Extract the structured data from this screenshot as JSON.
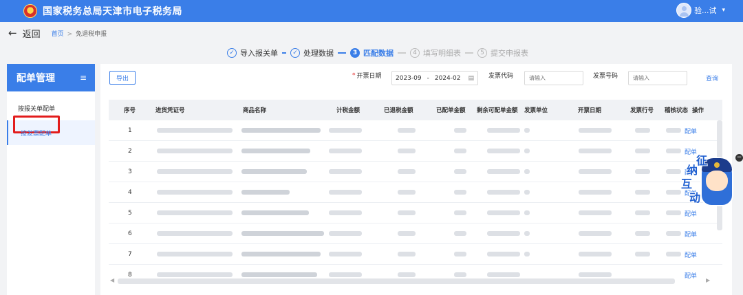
{
  "header": {
    "title": "国家税务总局天津市电子税务局",
    "user_name": "验...试"
  },
  "subnav": {
    "back_label": "返回",
    "breadcrumb_home": "首页",
    "breadcrumb_sep": ">",
    "breadcrumb_current": "免退税申报"
  },
  "steps": [
    {
      "num": "✓",
      "label": "导入报关单",
      "state": "done"
    },
    {
      "num": "✓",
      "label": "处理数据",
      "state": "done"
    },
    {
      "num": "3",
      "label": "匹配数据",
      "state": "active"
    },
    {
      "num": "4",
      "label": "填写明细表",
      "state": "todo"
    },
    {
      "num": "5",
      "label": "提交申报表",
      "state": "todo"
    }
  ],
  "sidebar": {
    "title": "配单管理",
    "menu_icon": "≡",
    "items": [
      {
        "label": "按报关单配单"
      },
      {
        "label": "按发票配单"
      }
    ]
  },
  "toolbar": {
    "export_label": "导出",
    "date_label": "开票日期",
    "date_start": "2023-09",
    "date_sep": "-",
    "date_end": "2024-02",
    "invoice_code_label": "发票代码",
    "invoice_code_placeholder": "请输入",
    "invoice_no_label": "发票号码",
    "invoice_no_placeholder": "请输入",
    "query_label": "查询"
  },
  "table": {
    "columns": [
      "序号",
      "进货凭证号",
      "商品名称",
      "计税金额",
      "已退税金额",
      "已配单金额",
      "剩余可配单金额",
      "发票单位",
      "开票日期",
      "发票行号",
      "稽核状态",
      "操作"
    ],
    "rows": [
      {
        "idx": "1",
        "op": "配单"
      },
      {
        "idx": "2",
        "op": "配单"
      },
      {
        "idx": "3",
        "op": "配单"
      },
      {
        "idx": "4",
        "op": "配单"
      },
      {
        "idx": "5",
        "op": "配单"
      },
      {
        "idx": "6",
        "op": "配单"
      },
      {
        "idx": "7",
        "op": "配单"
      },
      {
        "idx": "8",
        "op": "配单"
      }
    ]
  },
  "mascot": {
    "chars": [
      "征",
      "纳",
      "互",
      "动"
    ]
  },
  "colors": {
    "primary": "#3a7ee8",
    "highlight": "#e21c1c"
  }
}
